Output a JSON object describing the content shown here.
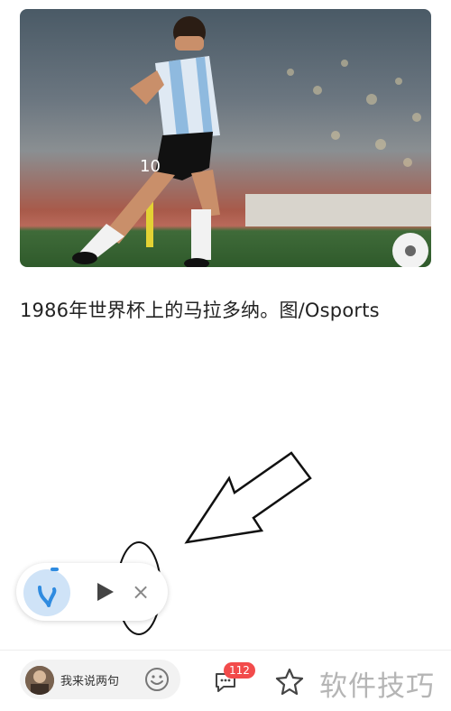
{
  "article": {
    "caption": "1986年世界杯上的马拉多纳。图/Osports"
  },
  "float_player": {
    "icons": [
      "headphone-wave-icon",
      "play-icon",
      "close-icon"
    ],
    "close_glyph": "×"
  },
  "bottom_bar": {
    "comment_placeholder": "我来说两句",
    "comment_count": "112",
    "icons": [
      "avatar",
      "emoji-icon",
      "comment-icon",
      "star-icon"
    ]
  },
  "watermark": {
    "text": "软件技巧"
  },
  "colors": {
    "badge": "#f24b4b",
    "float_icon_bg": "#cfe3f7",
    "accent": "#2f8be0"
  }
}
